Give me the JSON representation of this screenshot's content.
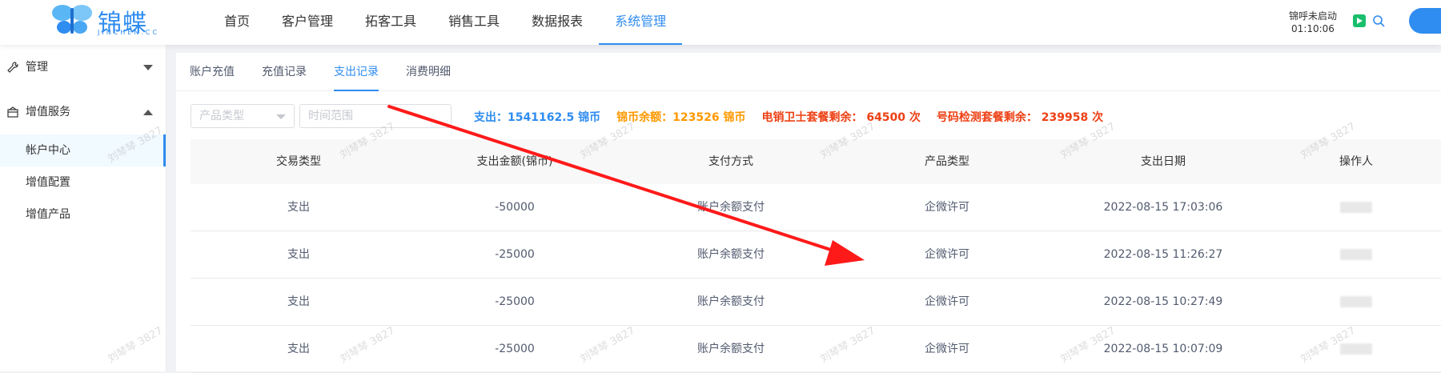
{
  "logo": {
    "wordmark": "锦蝶",
    "sub": "JINCHEN.CC"
  },
  "nav": [
    "首页",
    "客户管理",
    "拓客工具",
    "销售工具",
    "数据报表",
    "系统管理"
  ],
  "nav_active": 5,
  "top_status": {
    "line1": "锦呼未启动",
    "line2": "01:10:06"
  },
  "sidebar": {
    "group1": "管理",
    "group2": "增值服务",
    "items": [
      "帐户中心",
      "增值配置",
      "增值产品"
    ]
  },
  "tabs": [
    "账户充值",
    "充值记录",
    "支出记录",
    "消费明细"
  ],
  "tab_active": 2,
  "filters": {
    "product_type_placeholder": "产品类型",
    "date_placeholder": "时间范围"
  },
  "stats": [
    {
      "text": "支出：1541162.5 锦币",
      "color": "#2f8cf0"
    },
    {
      "text": "锦币余额：123526 锦币",
      "color": "#ff9900"
    },
    {
      "text": "电销卫士套餐剩余： 64500 次",
      "color": "#ed4014"
    },
    {
      "text": "号码检测套餐剩余： 239958 次",
      "color": "#ed4014"
    }
  ],
  "table": {
    "headers": [
      "交易类型",
      "支出金额(锦币)",
      "支付方式",
      "产品类型",
      "支出日期",
      "操作人"
    ],
    "rows": [
      [
        "支出",
        "-50000",
        "账户余额支付",
        "企微许可",
        "2022-08-15 17:03:06"
      ],
      [
        "支出",
        "-25000",
        "账户余额支付",
        "企微许可",
        "2022-08-15 11:26:27"
      ],
      [
        "支出",
        "-25000",
        "账户余额支付",
        "企微许可",
        "2022-08-15 10:27:49"
      ],
      [
        "支出",
        "-25000",
        "账户余额支付",
        "企微许可",
        "2022-08-15 10:07:09"
      ]
    ]
  },
  "watermark": "刘琴琴 3827",
  "colors": {
    "accent": "#2f8cf0",
    "arrow": "#ff1a1a"
  }
}
